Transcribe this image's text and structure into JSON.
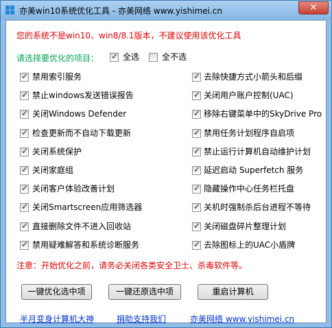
{
  "window": {
    "title": "亦美win10系统优化工具 - 亦美网络 www.yishimei.cn",
    "close_label": "✕"
  },
  "warning": "您的系统不是win10、win8/8.1版本，不建议使用该优化工具",
  "selection": {
    "label": "请选择要优化的项目：",
    "select_all": "全选",
    "select_none": "全不选",
    "select_all_checked": true,
    "select_none_checked": false
  },
  "options": {
    "left": [
      {
        "label": "禁用索引服务",
        "checked": true
      },
      {
        "label": "禁止windows发送错误报告",
        "checked": true
      },
      {
        "label": "关闭Windows Defender",
        "checked": true
      },
      {
        "label": "检查更新而不自动下载更新",
        "checked": true
      },
      {
        "label": "关闭系统保护",
        "checked": true
      },
      {
        "label": "关闭家庭组",
        "checked": true
      },
      {
        "label": "关闭客户体验改善计划",
        "checked": true
      },
      {
        "label": "关闭Smartscreen应用筛选器",
        "checked": true
      },
      {
        "label": "直接删除文件不进入回收站",
        "checked": true
      },
      {
        "label": "禁用疑难解答和系统诊断服务",
        "checked": true
      }
    ],
    "right": [
      {
        "label": "去除快捷方式小箭头和后缀",
        "checked": true
      },
      {
        "label": "关闭用户账户控制(UAC)",
        "checked": true
      },
      {
        "label": "移除右键菜单中的SkyDrive Pro",
        "checked": true
      },
      {
        "label": "禁用任务计划程序自启项",
        "checked": true
      },
      {
        "label": "禁止运行计算机自动维护计划",
        "checked": true
      },
      {
        "label": "延迟启动 Superfetch 服务",
        "checked": true
      },
      {
        "label": "隐藏操作中心任务栏托盘",
        "checked": true
      },
      {
        "label": "关机时强制杀后台进程不等待",
        "checked": true
      },
      {
        "label": "关闭磁盘碎片整理计划",
        "checked": true
      },
      {
        "label": "去除图标上的UAC小盾牌",
        "checked": true
      }
    ]
  },
  "note": "注意：开始优化之前，请务必关闭各类安全卫士、杀毒软件等。",
  "buttons": {
    "optimize": "一键优化选中项",
    "restore": "一键还原选中项",
    "restart": "重启计算机"
  },
  "links": {
    "link1": "半月变身计算机大神",
    "link2": "捐助支持我们",
    "link3": "亦美网络 www.yishimei.cn"
  }
}
